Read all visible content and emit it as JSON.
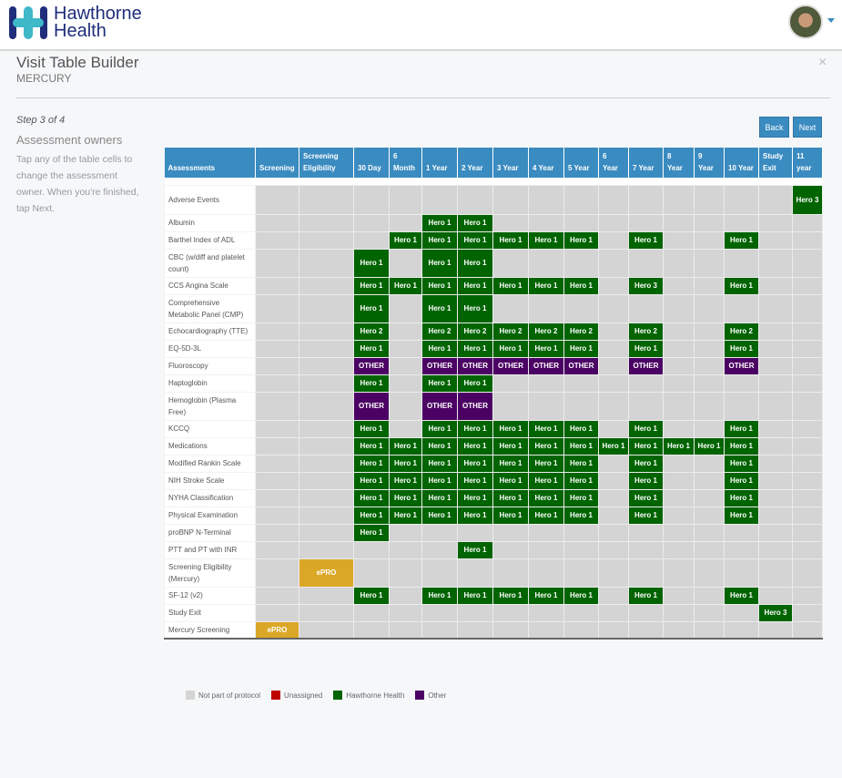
{
  "brand": {
    "name_line1": "Hawthorne",
    "name_line2": "Health"
  },
  "header": {
    "title": "Visit Table Builder",
    "subtitle": "MERCURY",
    "close": "×"
  },
  "step": {
    "label": "Step 3 of 4",
    "heading": "Assessment owners",
    "help": "Tap any of the table cells to change the assessment owner. When you're finished, tap Next."
  },
  "buttons": {
    "back": "Back",
    "next": "Next"
  },
  "colors": {
    "header": "#3a8bc0",
    "hawthorne": "#006400",
    "other": "#4b0063",
    "epro": "#dba726",
    "empty": "#d4d4d4",
    "unassigned": "#c00000"
  },
  "table": {
    "first_header": "Assessments",
    "columns": [
      [
        "Screening"
      ],
      [
        "Screening",
        "Eligibility"
      ],
      [
        "30 Day"
      ],
      [
        "6",
        "Month"
      ],
      [
        "1 Year"
      ],
      [
        "2 Year"
      ],
      [
        "3 Year"
      ],
      [
        "4 Year"
      ],
      [
        "5 Year"
      ],
      [
        "6",
        "Year"
      ],
      [
        "7 Year"
      ],
      [
        "8",
        "Year"
      ],
      [
        "9",
        "Year"
      ],
      [
        "10 Year"
      ],
      [
        "Study",
        "Exit"
      ],
      [
        "11",
        "year"
      ]
    ],
    "rows": [
      {
        "name": "Adverse Events",
        "cells": [
          "",
          "",
          "",
          "",
          "",
          "",
          "",
          "",
          "",
          "",
          "",
          "",
          "",
          "",
          "",
          "Hero 3"
        ]
      },
      {
        "name": "Albumin",
        "cells": [
          "",
          "",
          "",
          "",
          "Hero 1",
          "Hero 1",
          "",
          "",
          "",
          "",
          "",
          "",
          "",
          "",
          "",
          ""
        ]
      },
      {
        "name": "Barthel Index of ADL",
        "cells": [
          "",
          "",
          "",
          "Hero 1",
          "Hero 1",
          "Hero 1",
          "Hero 1",
          "Hero 1",
          "Hero 1",
          "",
          "Hero 1",
          "",
          "",
          "Hero 1",
          "",
          ""
        ]
      },
      {
        "name": "CBC (w/diff and platelet count)",
        "cells": [
          "",
          "",
          "Hero 1",
          "",
          "Hero 1",
          "Hero 1",
          "",
          "",
          "",
          "",
          "",
          "",
          "",
          "",
          "",
          ""
        ]
      },
      {
        "name": "CCS Angina Scale",
        "cells": [
          "",
          "",
          "Hero 1",
          "Hero 1",
          "Hero 1",
          "Hero 1",
          "Hero 1",
          "Hero 1",
          "Hero 1",
          "",
          "Hero 3",
          "",
          "",
          "Hero 1",
          "",
          ""
        ]
      },
      {
        "name": "Comprehensive Metabolic Panel (CMP)",
        "cells": [
          "",
          "",
          "Hero 1",
          "",
          "Hero 1",
          "Hero 1",
          "",
          "",
          "",
          "",
          "",
          "",
          "",
          "",
          "",
          ""
        ]
      },
      {
        "name": "Echocardiography (TTE)",
        "cells": [
          "",
          "",
          "Hero 2",
          "",
          "Hero 2",
          "Hero 2",
          "Hero 2",
          "Hero 2",
          "Hero 2",
          "",
          "Hero 2",
          "",
          "",
          "Hero 2",
          "",
          ""
        ]
      },
      {
        "name": "EQ-5D-3L",
        "cells": [
          "",
          "",
          "Hero 1",
          "",
          "Hero 1",
          "Hero 1",
          "Hero 1",
          "Hero 1",
          "Hero 1",
          "",
          "Hero 1",
          "",
          "",
          "Hero 1",
          "",
          ""
        ]
      },
      {
        "name": "Fluoroscopy",
        "cells": [
          "",
          "",
          "OTHER",
          "",
          "OTHER",
          "OTHER",
          "OTHER",
          "OTHER",
          "OTHER",
          "",
          "OTHER",
          "",
          "",
          "OTHER",
          "",
          ""
        ]
      },
      {
        "name": "Haptoglobin",
        "cells": [
          "",
          "",
          "Hero 1",
          "",
          "Hero 1",
          "Hero 1",
          "",
          "",
          "",
          "",
          "",
          "",
          "",
          "",
          "",
          ""
        ]
      },
      {
        "name": "Hemoglobin (Plasma Free)",
        "cells": [
          "",
          "",
          "OTHER",
          "",
          "OTHER",
          "OTHER",
          "",
          "",
          "",
          "",
          "",
          "",
          "",
          "",
          "",
          ""
        ]
      },
      {
        "name": "KCCQ",
        "cells": [
          "",
          "",
          "Hero 1",
          "",
          "Hero 1",
          "Hero 1",
          "Hero 1",
          "Hero 1",
          "Hero 1",
          "",
          "Hero 1",
          "",
          "",
          "Hero 1",
          "",
          ""
        ]
      },
      {
        "name": "Medications",
        "cells": [
          "",
          "",
          "Hero 1",
          "Hero 1",
          "Hero 1",
          "Hero 1",
          "Hero 1",
          "Hero 1",
          "Hero 1",
          "Hero 1",
          "Hero 1",
          "Hero 1",
          "Hero 1",
          "Hero 1",
          "",
          ""
        ]
      },
      {
        "name": "Modified Rankin Scale",
        "cells": [
          "",
          "",
          "Hero 1",
          "Hero 1",
          "Hero 1",
          "Hero 1",
          "Hero 1",
          "Hero 1",
          "Hero 1",
          "",
          "Hero 1",
          "",
          "",
          "Hero 1",
          "",
          ""
        ]
      },
      {
        "name": "NIH Stroke Scale",
        "cells": [
          "",
          "",
          "Hero 1",
          "Hero 1",
          "Hero 1",
          "Hero 1",
          "Hero 1",
          "Hero 1",
          "Hero 1",
          "",
          "Hero 1",
          "",
          "",
          "Hero 1",
          "",
          ""
        ]
      },
      {
        "name": "NYHA Classification",
        "cells": [
          "",
          "",
          "Hero 1",
          "Hero 1",
          "Hero 1",
          "Hero 1",
          "Hero 1",
          "Hero 1",
          "Hero 1",
          "",
          "Hero 1",
          "",
          "",
          "Hero 1",
          "",
          ""
        ]
      },
      {
        "name": "Physical Examination",
        "cells": [
          "",
          "",
          "Hero 1",
          "Hero 1",
          "Hero 1",
          "Hero 1",
          "Hero 1",
          "Hero 1",
          "Hero 1",
          "",
          "Hero 1",
          "",
          "",
          "Hero 1",
          "",
          ""
        ]
      },
      {
        "name": "proBNP N-Terminal",
        "cells": [
          "",
          "",
          "Hero 1",
          "",
          "",
          "",
          "",
          "",
          "",
          "",
          "",
          "",
          "",
          "",
          "",
          ""
        ]
      },
      {
        "name": "PTT and PT with INR",
        "cells": [
          "",
          "",
          "",
          "",
          "",
          "Hero 1",
          "",
          "",
          "",
          "",
          "",
          "",
          "",
          "",
          "",
          ""
        ]
      },
      {
        "name": "Screening Eligibility (Mercury)",
        "cells": [
          "",
          "ePRO",
          "",
          "",
          "",
          "",
          "",
          "",
          "",
          "",
          "",
          "",
          "",
          "",
          "",
          ""
        ]
      },
      {
        "name": "SF-12 (v2)",
        "cells": [
          "",
          "",
          "Hero 1",
          "",
          "Hero 1",
          "Hero 1",
          "Hero 1",
          "Hero 1",
          "Hero 1",
          "",
          "Hero 1",
          "",
          "",
          "Hero 1",
          "",
          ""
        ]
      },
      {
        "name": "Study Exit",
        "cells": [
          "",
          "",
          "",
          "",
          "",
          "",
          "",
          "",
          "",
          "",
          "",
          "",
          "",
          "",
          "Hero 3",
          ""
        ]
      },
      {
        "name": "Mercury Screening",
        "cells": [
          "ePRO",
          "",
          "",
          "",
          "",
          "",
          "",
          "",
          "",
          "",
          "",
          "",
          "",
          "",
          "",
          ""
        ]
      }
    ]
  },
  "legend": [
    {
      "label": "Not part of protocol",
      "color": "#d4d4d4"
    },
    {
      "label": "Unassigned",
      "color": "#c00000"
    },
    {
      "label": "Hawthorne Health",
      "color": "#006400"
    },
    {
      "label": "Other",
      "color": "#4b0063"
    }
  ]
}
